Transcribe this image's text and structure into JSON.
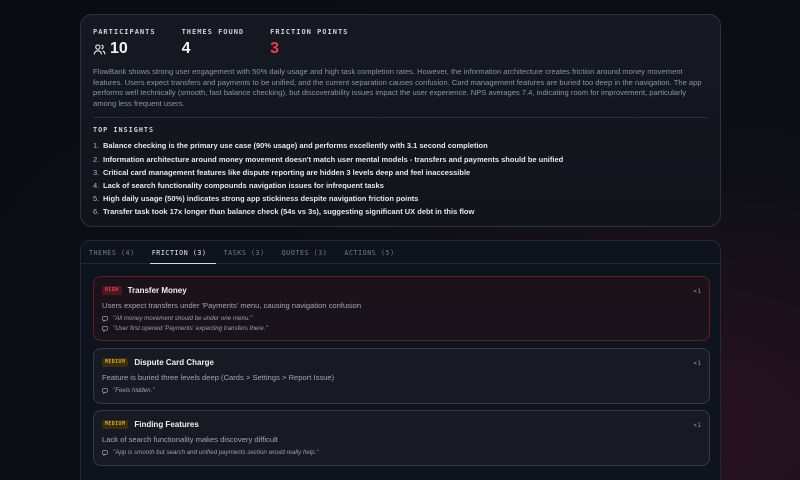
{
  "stats": [
    {
      "label": "PARTICIPANTS",
      "value": "10",
      "icon": "users-icon"
    },
    {
      "label": "THEMES FOUND",
      "value": "4"
    },
    {
      "label": "FRICTION POINTS",
      "value": "3",
      "color": "#ef3b4e"
    }
  ],
  "summary": "FlowBank shows strong user engagement with 50% daily usage and high task completion rates. However, the information architecture creates friction around money movement features. Users expect transfers and payments to be unified, and the current separation causes confusion. Card management features are buried too deep in the navigation. The app performs well technically (smooth, fast balance checking), but discoverability issues impact the user experience. NPS averages 7.4, indicating room for improvement, particularly among less frequent users.",
  "insights_title": "TOP INSIGHTS",
  "insights": [
    {
      "num": "1.",
      "text": "Balance checking is the primary use case (90% usage) and performs excellently with 3.1 second completion"
    },
    {
      "num": "2.",
      "text": "Information architecture around money movement doesn't match user mental models - transfers and payments should be unified"
    },
    {
      "num": "3.",
      "text": "Critical card management features like dispute reporting are hidden 3 levels deep and feel inaccessible"
    },
    {
      "num": "4.",
      "text": "Lack of search functionality compounds navigation issues for infrequent tasks"
    },
    {
      "num": "5.",
      "text": "High daily usage (50%) indicates strong app stickiness despite navigation friction points"
    },
    {
      "num": "6.",
      "text": "Transfer task took 17x longer than balance check (54s vs 3s), suggesting significant UX debt in this flow"
    }
  ],
  "tabs": [
    {
      "label": "THEMES (4)"
    },
    {
      "label": "FRICTION (3)",
      "active": true
    },
    {
      "label": "TASKS (3)"
    },
    {
      "label": "QUOTES (3)"
    },
    {
      "label": "ACTIONS (5)"
    }
  ],
  "friction": [
    {
      "severity": "HIGH",
      "title": "Transfer Money",
      "count": "×1",
      "description": "Users expect transfers under 'Payments' menu, causing navigation confusion",
      "quotes": [
        "\"All money movement should be under one menu.\"",
        "\"User first opened 'Payments' expecting transfers there.\""
      ]
    },
    {
      "severity": "MEDIUM",
      "title": "Dispute Card Charge",
      "count": "×1",
      "description": "Feature is buried three levels deep (Cards > Settings > Report Issue)",
      "quotes": [
        "\"Feels hidden.\""
      ]
    },
    {
      "severity": "MEDIUM",
      "title": "Finding Features",
      "count": "×1",
      "description": "Lack of search functionality makes discovery difficult",
      "quotes": [
        "\"App is smooth but search and unified payments section would really help.\""
      ]
    }
  ]
}
